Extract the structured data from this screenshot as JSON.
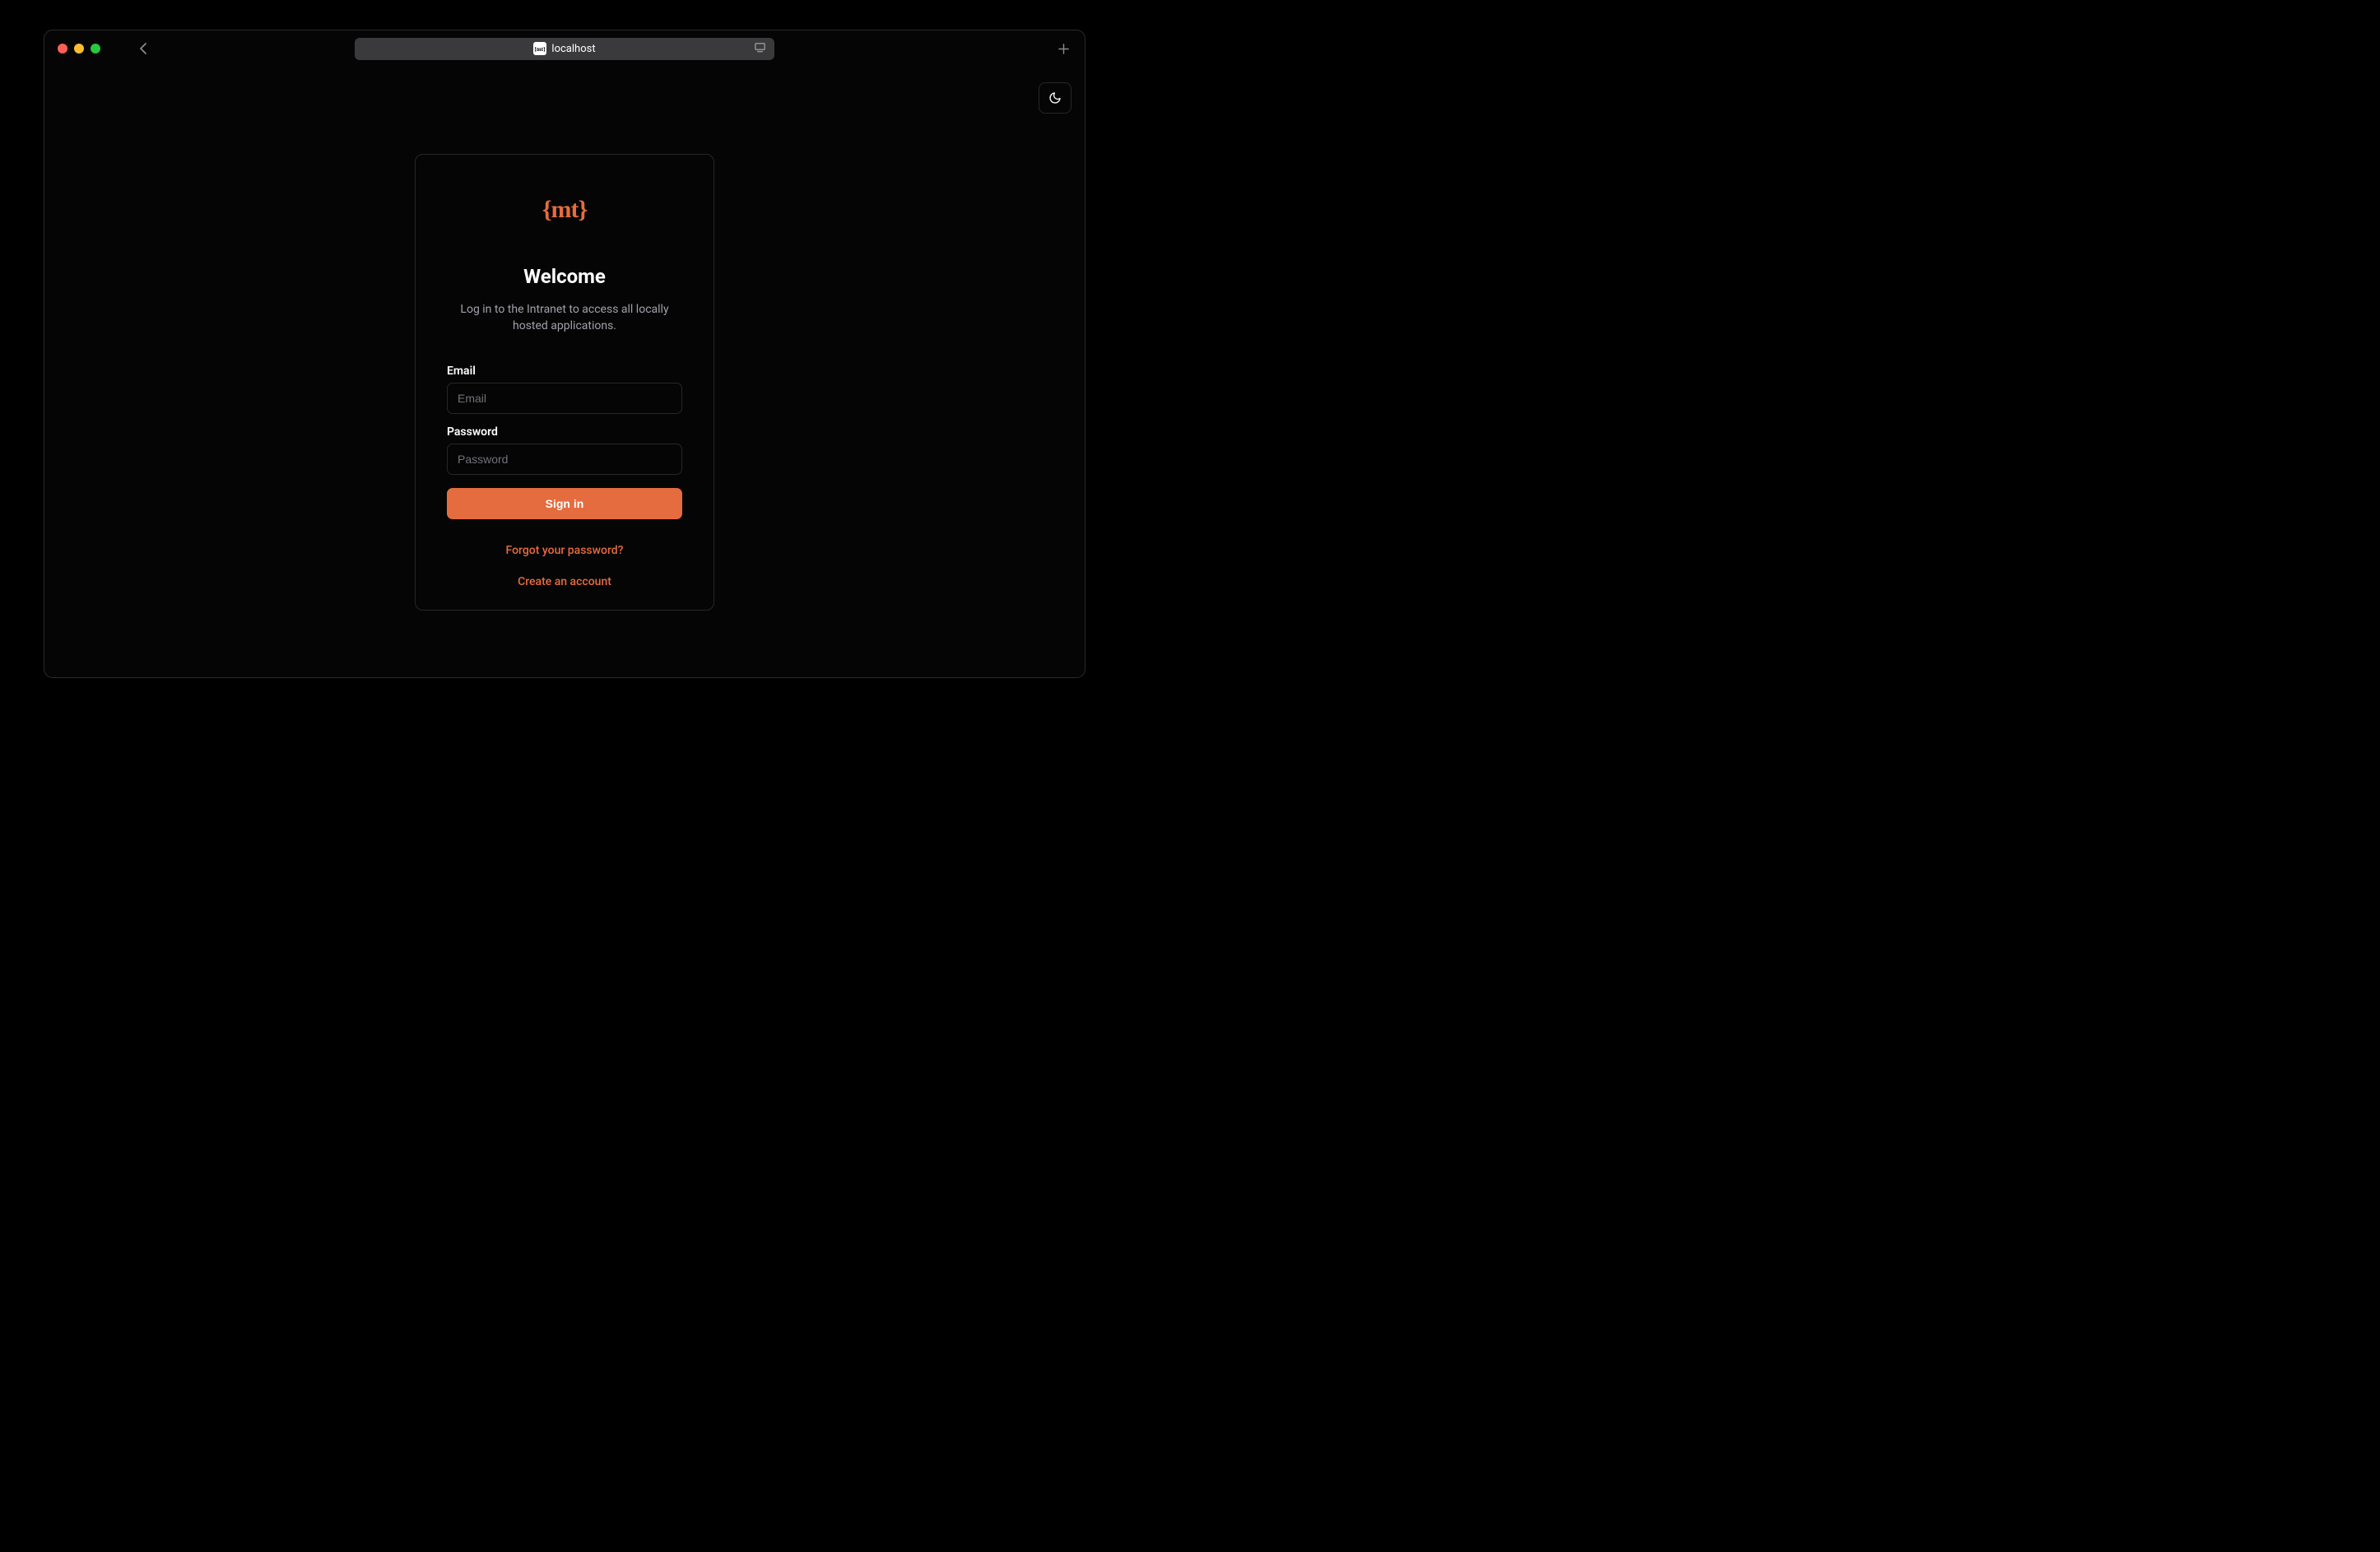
{
  "browser": {
    "url_display": "localhost"
  },
  "logo": {
    "text": "{mt}"
  },
  "card": {
    "title": "Welcome",
    "subtitle": "Log in to the Intranet to access all locally hosted applications."
  },
  "form": {
    "email_label": "Email",
    "email_placeholder": "Email",
    "password_label": "Password",
    "password_placeholder": "Password",
    "submit_label": "Sign in"
  },
  "links": {
    "forgot": "Forgot your password?",
    "create": "Create an account"
  },
  "colors": {
    "accent": "#e56c3e",
    "border": "#27272a",
    "muted_text": "#a1a1aa",
    "placeholder": "#71717a",
    "background": "#050505"
  }
}
